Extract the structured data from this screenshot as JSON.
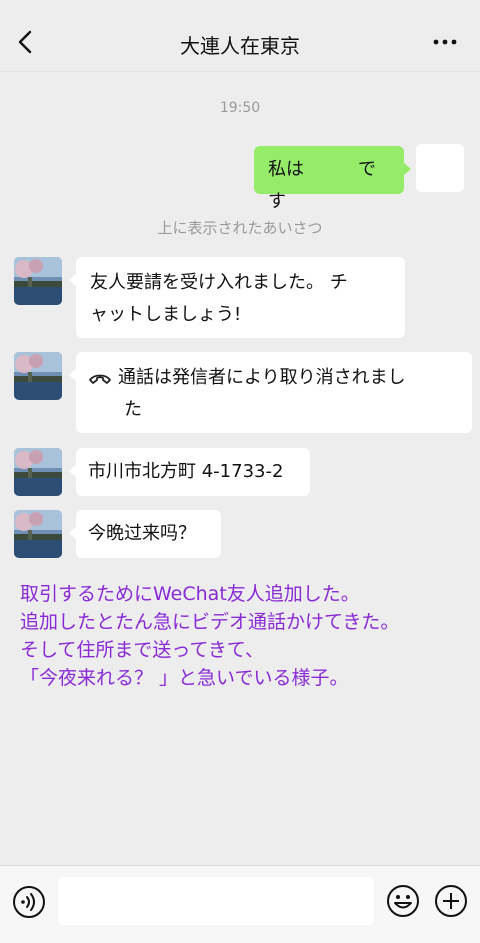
{
  "header": {
    "title": "大連人在東京"
  },
  "timestamp": "19:50",
  "messages": {
    "outgoing_text": "私は　　　です",
    "system_note": "上に表示されたあいさつ",
    "incoming_1_line1": "友人要請を受け入れました。 チ",
    "incoming_1_line2": "ャットしましょう!",
    "call_line1": "通話は発信者により取り消されまし",
    "call_line2": "た",
    "address": "市川市北方町 4-1733-2",
    "question": "今晩过来吗？"
  },
  "annotation": {
    "line1": "取引するためにWeChat友人追加した。",
    "line2": "追加したとたん急にビデオ通話かけてきた。",
    "line3": "そして住所まで送ってきて、",
    "line4": "「今夜来れる？ 」と急いでいる様子。"
  },
  "icons": {
    "back": "back-arrow-icon",
    "more": "more-dots-icon",
    "call": "phone-hangup-icon",
    "voice": "voice-input-icon",
    "emoji": "emoji-icon",
    "plus": "plus-icon"
  },
  "colors": {
    "background": "#ededed",
    "outgoing_bubble": "#95ec69",
    "incoming_bubble": "#ffffff",
    "annotation_text": "#8a2ad6",
    "timestamp_text": "#9a9a9a"
  }
}
